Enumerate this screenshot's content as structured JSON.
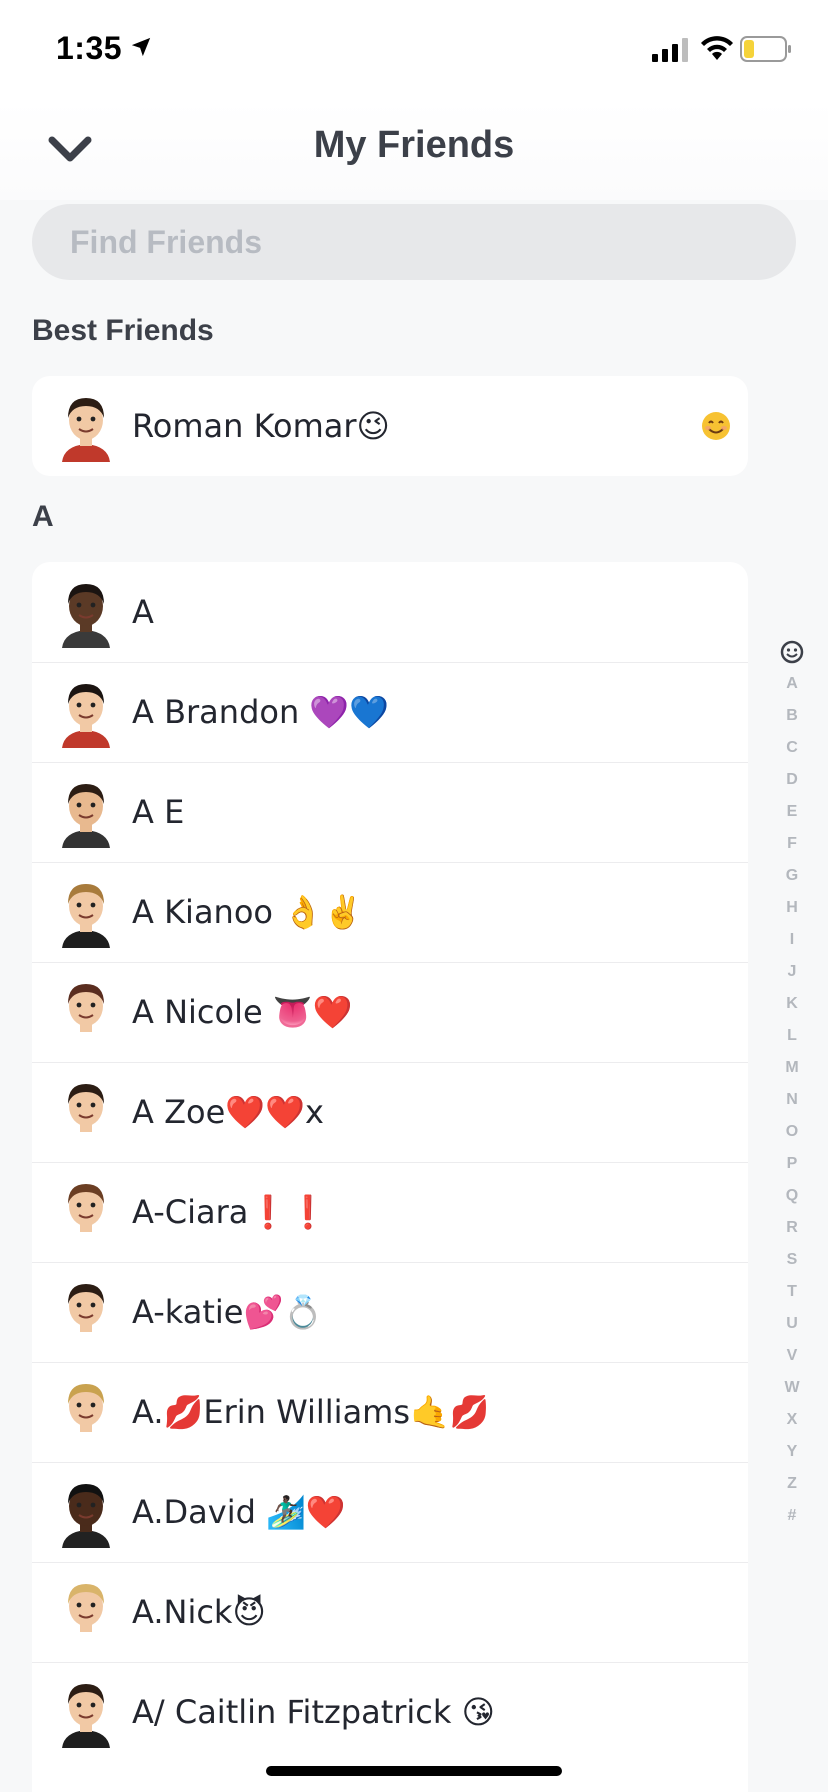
{
  "status_bar": {
    "time": "1:35"
  },
  "header": {
    "title": "My Friends"
  },
  "search": {
    "placeholder": "Find Friends"
  },
  "best_friends": {
    "label": "Best Friends",
    "friends": [
      {
        "name": "Roman Komar😉",
        "badge_icon": "smiling-face-emoji",
        "avatar": "avatar-male-beard",
        "skin": "#f1c9a5",
        "hair": "#2c1d14",
        "shirt": "#c0392b"
      }
    ]
  },
  "section_a": {
    "label": "A",
    "friends": [
      {
        "name": "A",
        "skin": "#5b3a26",
        "hair": "#1b1411",
        "shirt": "#3a3a3a"
      },
      {
        "name": "A Brandon 💜💙",
        "skin": "#f1c9a5",
        "hair": "#1b1411",
        "shirt": "#c0392b"
      },
      {
        "name": "A E",
        "skin": "#e8b98f",
        "hair": "#2c1d14",
        "shirt": "#333333"
      },
      {
        "name": "A Kianoo 👌✌️",
        "skin": "#f1c9a5",
        "hair": "#a87b3c",
        "shirt": "#1e1e1e"
      },
      {
        "name": "A Nicole 👅❤️",
        "skin": "#f1c9a5",
        "hair": "#5a2d1f",
        "shirt": "#ffffff"
      },
      {
        "name": "A Zoe❤️❤️x",
        "skin": "#f1c9a5",
        "hair": "#2c1d14",
        "shirt": "#ffffff"
      },
      {
        "name": "A-Ciara❗️❗️",
        "skin": "#f1c9a5",
        "hair": "#6b3e23",
        "shirt": "#ffffff"
      },
      {
        "name": "A-katie💕💍",
        "skin": "#f1c9a5",
        "hair": "#2c1d14",
        "shirt": "#ffffff"
      },
      {
        "name": "A.💋Erin Williams🤙💋",
        "skin": "#f1c9a5",
        "hair": "#c9a24f",
        "shirt": "#ffffff"
      },
      {
        "name": "A.David 🏄🏿‍♂️❤️",
        "skin": "#4a2b1b",
        "hair": "#111111",
        "shirt": "#222222"
      },
      {
        "name": "A.Nick😈",
        "skin": "#f1c9a5",
        "hair": "#d9b46a",
        "shirt": "#ffffff"
      },
      {
        "name": "A/ Caitlin Fitzpatrick 😘",
        "skin": "#f1c9a5",
        "hair": "#2c1d14",
        "shirt": "#1e1e1e"
      }
    ]
  },
  "alphabet_index": [
    "A",
    "B",
    "C",
    "D",
    "E",
    "F",
    "G",
    "H",
    "I",
    "J",
    "K",
    "L",
    "M",
    "N",
    "O",
    "P",
    "Q",
    "R",
    "S",
    "T",
    "U",
    "V",
    "W",
    "X",
    "Y",
    "Z",
    "#"
  ],
  "colors": {
    "accent_text": "#3c4049",
    "card_bg": "#ffffff",
    "page_bg": "#f7f8f9",
    "index_letter": "#b3b7bd",
    "battery_low": "#f5d33a"
  }
}
